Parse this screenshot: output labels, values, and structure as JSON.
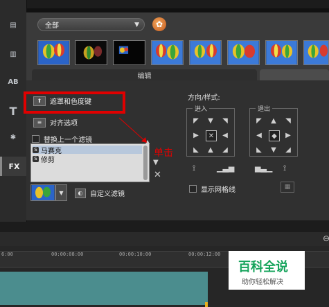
{
  "rail": {
    "items": [
      {
        "name": "media",
        "glyph": "▤"
      },
      {
        "name": "film",
        "glyph": "▥"
      },
      {
        "name": "transition",
        "glyph": "AB"
      },
      {
        "name": "title",
        "glyph": "T"
      },
      {
        "name": "graphics",
        "glyph": "✱"
      },
      {
        "name": "fx",
        "glyph": "FX"
      }
    ]
  },
  "library": {
    "filter_dropdown": "全部",
    "gear_icon": "✿"
  },
  "tabs": {
    "edit_label": "编辑"
  },
  "options": {
    "mask_chroma_label": "遮罩和色度键",
    "align_label": "对齐选项",
    "replace_filter_label": "替换上一个滤镜"
  },
  "filters": [
    {
      "label": "马赛克",
      "selected": true
    },
    {
      "label": "修剪",
      "selected": false
    }
  ],
  "custom_filter_label": "自定义滤镜",
  "direction": {
    "title": "方向/样式:",
    "enter_label": "进入",
    "exit_label": "退出",
    "show_grid_label": "显示网格线"
  },
  "annotation": {
    "click_label": "单击",
    "color": "#e00000"
  },
  "timeline": {
    "ticks": [
      "6:00",
      "00:00:08:00",
      "00:00:10:00",
      "00:00:12:00"
    ],
    "track_color": "#4b8d8e"
  },
  "watermark": {
    "main": "百科全说",
    "sub": "助你轻松解决"
  }
}
